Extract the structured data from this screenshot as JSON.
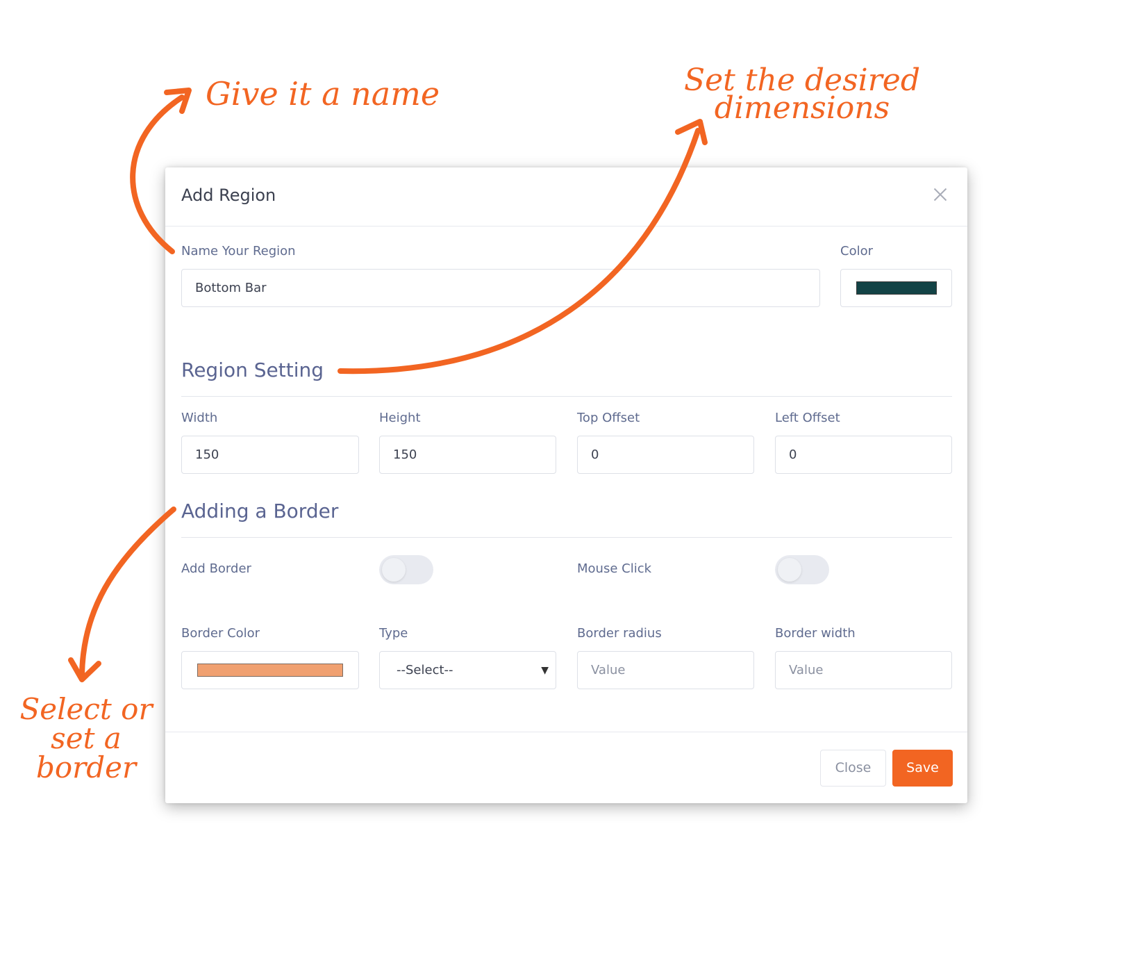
{
  "annotations": {
    "name": "Give it a name",
    "dimensions_line1": "Set the desired",
    "dimensions_line2": "dimensions",
    "border_line1": "Select or",
    "border_line2": "set a",
    "border_line3": "border",
    "accent_color": "#f26522"
  },
  "modal": {
    "title": "Add Region",
    "close_icon": "close-icon",
    "name_label": "Name Your Region",
    "name_value": "Bottom Bar",
    "color_label": "Color",
    "color_value": "#134346",
    "region_setting_title": "Region Setting",
    "width_label": "Width",
    "width_value": "150",
    "height_label": "Height",
    "height_value": "150",
    "top_offset_label": "Top Offset",
    "top_offset_value": "0",
    "left_offset_label": "Left Offset",
    "left_offset_value": "0",
    "border_title": "Adding a Border",
    "add_border_label": "Add Border",
    "add_border_on": false,
    "mouse_click_label": "Mouse Click",
    "mouse_click_on": false,
    "border_color_label": "Border Color",
    "border_color_value": "#f0a070",
    "type_label": "Type",
    "type_value": "--Select--",
    "border_radius_label": "Border radius",
    "border_radius_placeholder": "Value",
    "border_width_label": "Border width",
    "border_width_placeholder": "Value",
    "close_button": "Close",
    "save_button": "Save",
    "save_color": "#f26522"
  }
}
